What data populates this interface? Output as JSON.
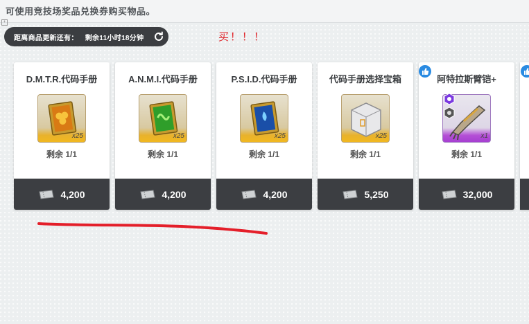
{
  "header": {
    "instruction": "可使用竞技场奖品兑换券购买物品。",
    "refresh_label": "距离商品更新还有：",
    "refresh_timer": "剩余11小时18分钟"
  },
  "annotation": {
    "buy_text": "买！！！",
    "color": "#e0262b"
  },
  "colors": {
    "price_bar": "#3c3e42",
    "gold_rarity": "#f1b820",
    "purple_rarity": "#a63fd1",
    "like_badge": "#2a8be2"
  },
  "cards": [
    {
      "title": "D.M.T.R.代码手册",
      "icon": "code-manual-orange-icon",
      "quantity": "x25",
      "remaining": "剩余 1/1",
      "price": "4,200",
      "rarity": "gold"
    },
    {
      "title": "A.N.M.I.代码手册",
      "icon": "code-manual-green-icon",
      "quantity": "x25",
      "remaining": "剩余 1/1",
      "price": "4,200",
      "rarity": "gold"
    },
    {
      "title": "P.S.I.D.代码手册",
      "icon": "code-manual-blue-icon",
      "quantity": "x25",
      "remaining": "剩余 1/1",
      "price": "4,200",
      "rarity": "gold"
    },
    {
      "title": "代码手册选择宝箱",
      "icon": "selection-box-icon",
      "quantity": "x25",
      "remaining": "剩余 1/1",
      "price": "5,250",
      "rarity": "gold"
    },
    {
      "title": "阿特拉斯臂铠+",
      "icon": "mechanical-arm-icon",
      "quantity": "x1",
      "remaining": "剩余 1/1",
      "price": "32,000",
      "rarity": "purple"
    }
  ]
}
